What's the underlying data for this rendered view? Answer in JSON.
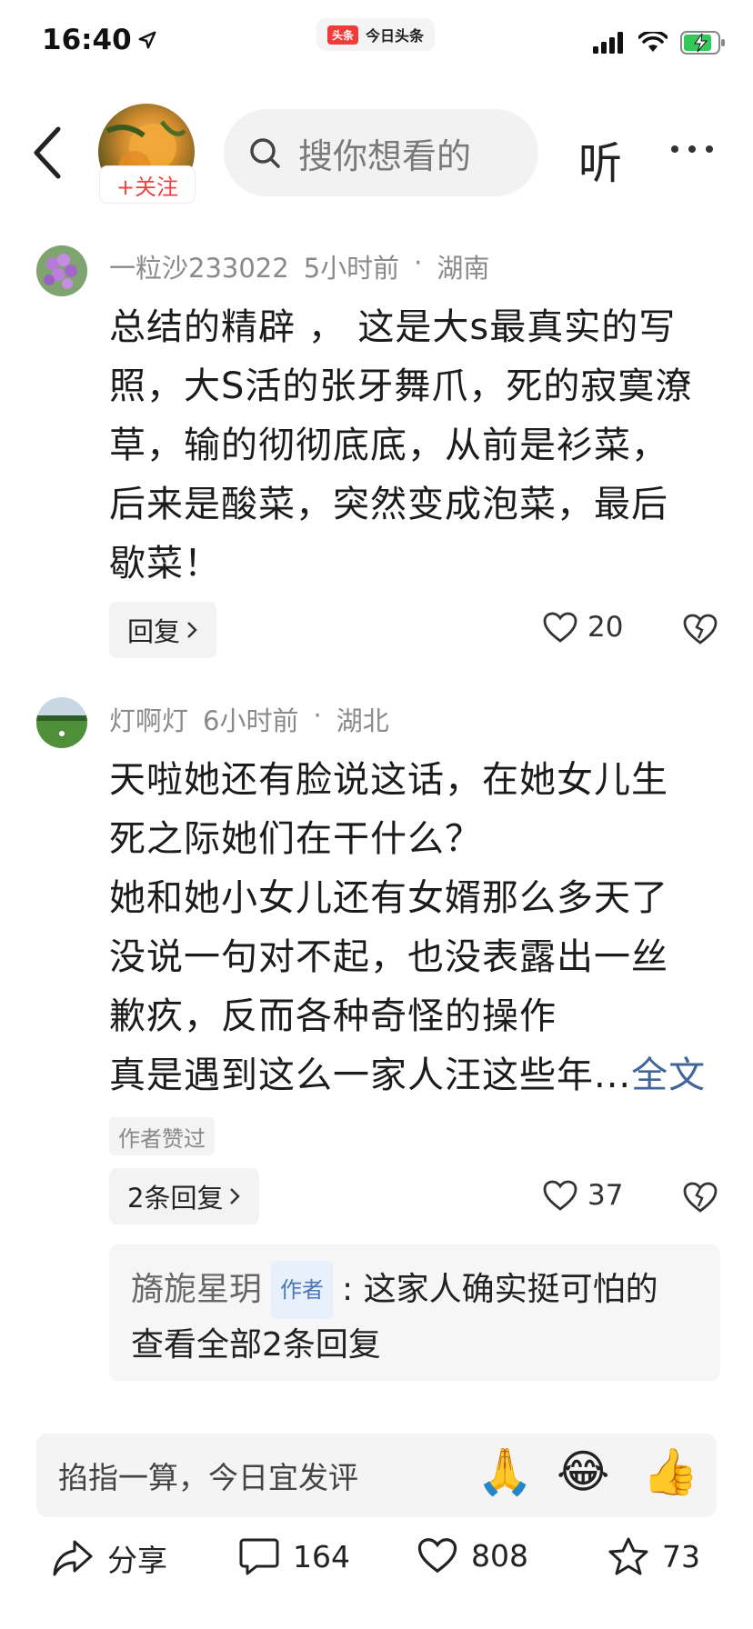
{
  "status": {
    "time": "16:40",
    "app_badge": "头条",
    "app_name": "今日头条"
  },
  "header": {
    "follow_label": "+关注",
    "search_placeholder": "搜你想看的",
    "listen_label": "听"
  },
  "comments": [
    {
      "user": "一粒沙233022",
      "time": "5小时前",
      "location": "湖南",
      "lines": [
        "总结的精辟 ， 这是大s最真实的写",
        "照，大S活的张牙舞爪，死的寂寞潦",
        "草，输的彻彻底底，从前是衫菜，",
        "后来是酸菜，突然变成泡菜，最后",
        "歇菜！"
      ],
      "reply_label": "回复",
      "likes": "20"
    },
    {
      "user": "灯啊灯",
      "time": "6小时前",
      "location": "湖北",
      "lines": [
        "天啦她还有脸说这话，在她女儿生",
        "死之际她们在干什么？",
        "她和她小女儿还有女婿那么多天了",
        "没说一句对不起，也没表露出一丝",
        "歉疚，反而各种奇怪的操作",
        "真是遇到这么一家人汪这些年..."
      ],
      "full_text_label": "全文",
      "author_liked": "作者赞过",
      "reply_label": "2条回复",
      "likes": "37",
      "sub_reply": {
        "name": "旖旎星玥",
        "tag": "作者",
        "text": ": 这家人确实挺可怕的",
        "view_all": "查看全部2条回复"
      }
    }
  ],
  "comment_bar": {
    "placeholder": "掐指一算，今日宜发评",
    "emojis": [
      "🙏",
      "😂",
      "👍"
    ]
  },
  "actions": {
    "share_label": "分享",
    "comments_count": "164",
    "likes_count": "808",
    "favorites_count": "73"
  }
}
